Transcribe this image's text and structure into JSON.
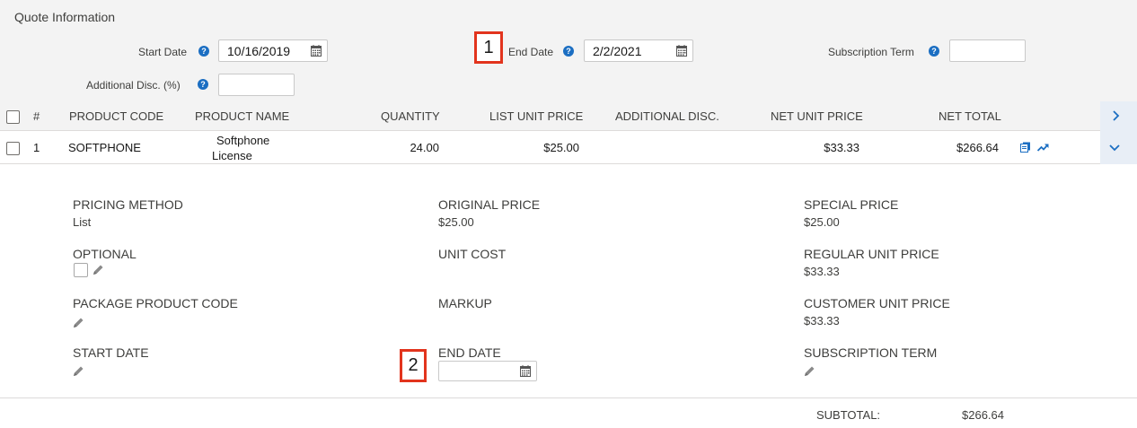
{
  "section_title": "Quote Information",
  "header_fields": {
    "start_date_label": "Start Date",
    "start_date_value": "10/16/2019",
    "end_date_label": "End Date",
    "end_date_value": "2/2/2021",
    "subscription_term_label": "Subscription Term",
    "subscription_term_value": "",
    "additional_disc_label": "Additional Disc. (%)",
    "additional_disc_value": "",
    "help_glyph": "?"
  },
  "callouts": {
    "one": "1",
    "two": "2"
  },
  "table": {
    "columns": [
      "#",
      "PRODUCT CODE",
      "PRODUCT NAME",
      "QUANTITY",
      "LIST UNIT PRICE",
      "ADDITIONAL DISC.",
      "NET UNIT PRICE",
      "NET TOTAL"
    ],
    "rows": [
      {
        "num": "1",
        "product_code": "SOFTPHONE",
        "product_name_line1": "Softphone",
        "product_name_line2": "License",
        "quantity": "24.00",
        "list_unit_price": "$25.00",
        "additional_disc": "",
        "net_unit_price": "$33.33",
        "net_total": "$266.64"
      }
    ]
  },
  "detail": {
    "pricing_method_label": "PRICING METHOD",
    "pricing_method_value": "List",
    "original_price_label": "ORIGINAL PRICE",
    "original_price_value": "$25.00",
    "special_price_label": "SPECIAL PRICE",
    "special_price_value": "$25.00",
    "optional_label": "OPTIONAL",
    "unit_cost_label": "UNIT COST",
    "regular_unit_price_label": "REGULAR UNIT PRICE",
    "regular_unit_price_value": "$33.33",
    "package_product_code_label": "PACKAGE PRODUCT CODE",
    "markup_label": "MARKUP",
    "customer_unit_price_label": "CUSTOMER UNIT PRICE",
    "customer_unit_price_value": "$33.33",
    "start_date_label": "START DATE",
    "end_date_label": "END DATE",
    "end_date_value": "",
    "subscription_term_label": "SUBSCRIPTION TERM"
  },
  "subtotal": {
    "label": "SUBTOTAL:",
    "value": "$266.64"
  },
  "icons": {
    "help": "question-icon",
    "calendar": "calendar-icon",
    "edit": "pencil-icon",
    "clone": "clone-icon",
    "trend": "trend-icon",
    "expand": "chevron-right-icon",
    "collapse": "chevron-down-icon"
  },
  "colors": {
    "accent": "#1b6ec2",
    "callout": "#e2341d"
  }
}
